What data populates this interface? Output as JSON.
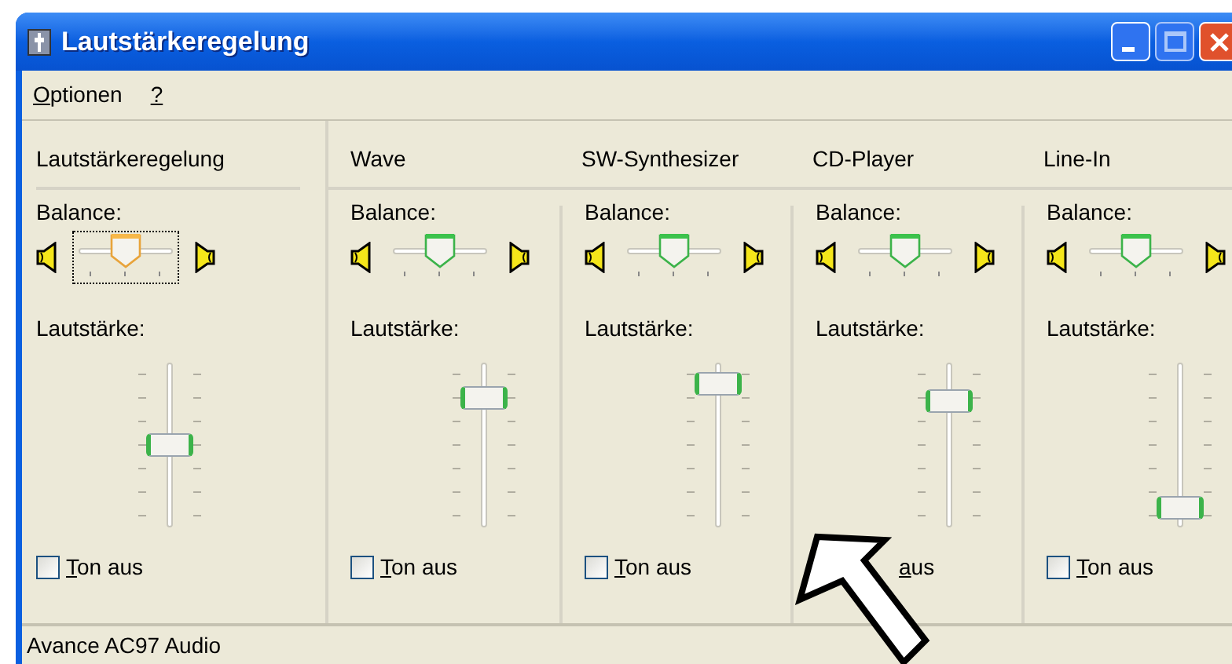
{
  "window": {
    "title": "Lautstärkeregelung"
  },
  "menu": [
    {
      "label": "Optionen"
    },
    {
      "label": "?"
    }
  ],
  "channels": [
    {
      "kind": "master",
      "name": "Lautstärkeregelung",
      "balance_label": "Balance:",
      "balance": {
        "level": 0.5,
        "focused": true
      },
      "volume_label": "Lautstärke:",
      "volume": {
        "level": 0.5
      },
      "mute": {
        "label": "Ton aus",
        "checked": false
      }
    },
    {
      "kind": "line",
      "name": "Wave",
      "balance_label": "Balance:",
      "balance": {
        "level": 0.5,
        "focused": false
      },
      "volume_label": "Lautstärke:",
      "volume": {
        "level": 0.83
      },
      "mute": {
        "label": "Ton aus",
        "checked": false
      }
    },
    {
      "kind": "line",
      "name": "SW-Synthesizer",
      "balance_label": "Balance:",
      "balance": {
        "level": 0.5,
        "focused": false
      },
      "volume_label": "Lautstärke:",
      "volume": {
        "level": 0.93
      },
      "mute": {
        "label": "Ton aus",
        "checked": false
      }
    },
    {
      "kind": "line",
      "name": "CD-Player",
      "balance_label": "Balance:",
      "balance": {
        "level": 0.5,
        "focused": false
      },
      "volume_label": "Lautstärke:",
      "volume": {
        "level": 0.81
      },
      "mute": {
        "label": "aus"
      }
    },
    {
      "kind": "line",
      "name": "Line-In",
      "balance_label": "Balance:",
      "balance": {
        "level": 0.5,
        "focused": false
      },
      "volume_label": "Lautstärke:",
      "volume": {
        "level": 0.05
      },
      "mute": {
        "label": "Ton aus",
        "checked": false
      }
    }
  ],
  "status_bar": "Avance AC97 Audio"
}
